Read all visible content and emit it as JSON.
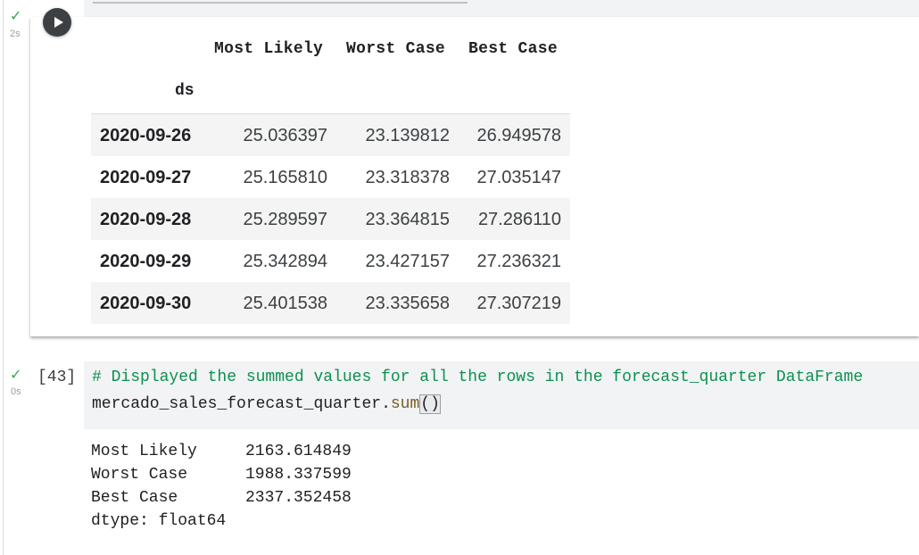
{
  "cell1": {
    "status_icon": "check-icon",
    "status_color": "#34a853",
    "exec_time": "2s",
    "run_icon": "play-icon",
    "dataframe": {
      "columns": [
        "Most Likely",
        "Worst Case",
        "Best Case"
      ],
      "index_name": "ds",
      "rows": [
        {
          "ds": "2020-09-26",
          "most_likely": "25.036397",
          "worst_case": "23.139812",
          "best_case": "26.949578"
        },
        {
          "ds": "2020-09-27",
          "most_likely": "25.165810",
          "worst_case": "23.318378",
          "best_case": "27.035147"
        },
        {
          "ds": "2020-09-28",
          "most_likely": "25.289597",
          "worst_case": "23.364815",
          "best_case": "27.286110"
        },
        {
          "ds": "2020-09-29",
          "most_likely": "25.342894",
          "worst_case": "23.427157",
          "best_case": "27.236321"
        },
        {
          "ds": "2020-09-30",
          "most_likely": "25.401538",
          "worst_case": "23.335658",
          "best_case": "27.307219"
        }
      ]
    }
  },
  "cell2": {
    "status_icon": "check-icon",
    "exec_time": "0s",
    "exec_count": "[43]",
    "code": {
      "comment": "# Displayed the summed values for all the rows in the forecast_quarter DataFrame",
      "object": "mercado_sales_forecast_quarter",
      "dot": ".",
      "method": "sum",
      "parens": "()"
    },
    "output": [
      {
        "label": "Most Likely",
        "value": "2163.614849"
      },
      {
        "label": "Worst Case",
        "value": "1988.337599"
      },
      {
        "label": "Best Case",
        "value": "2337.352458"
      }
    ],
    "dtype_line": "dtype: float64"
  }
}
